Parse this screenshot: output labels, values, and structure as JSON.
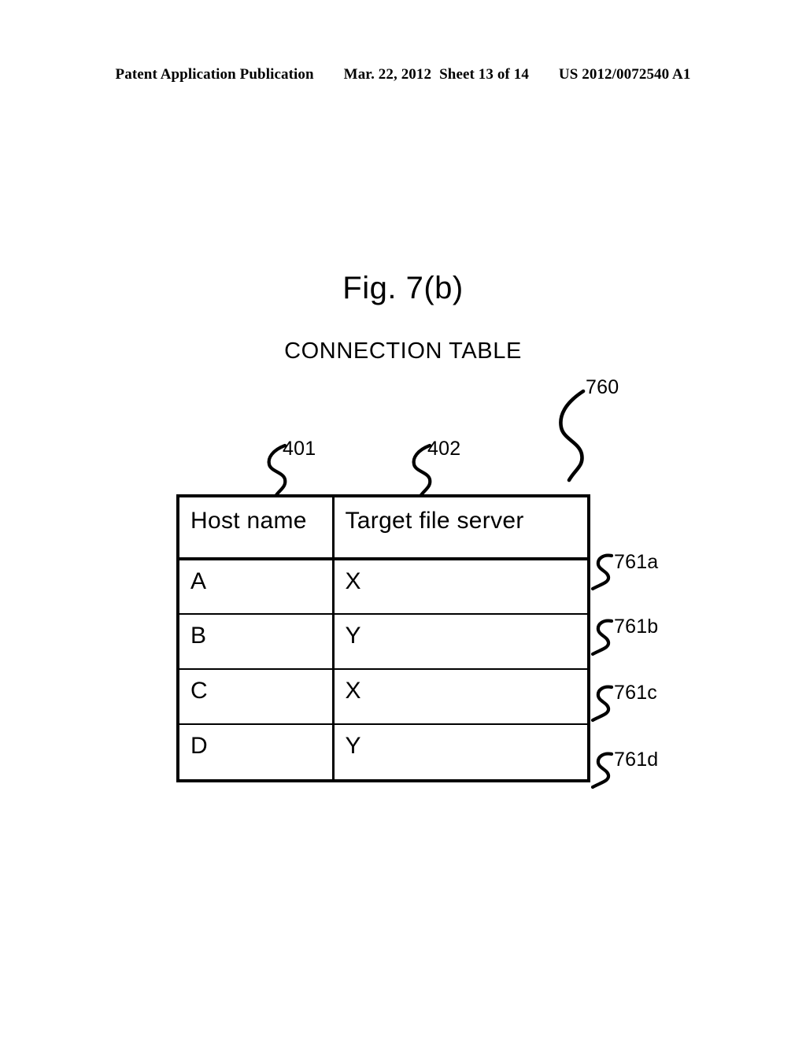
{
  "header": {
    "publication": "Patent Application Publication",
    "date": "Mar. 22, 2012",
    "sheet": "Sheet 13 of 14",
    "number": "US 2012/0072540 A1"
  },
  "figure": {
    "title": "Fig. 7(b)",
    "caption": "CONNECTION TABLE"
  },
  "refs": {
    "table": "760",
    "column_host": "401",
    "column_server": "402",
    "row_a": "761a",
    "row_b": "761b",
    "row_c": "761c",
    "row_d": "761d"
  },
  "table": {
    "columns": [
      "Host name",
      "Target file server"
    ],
    "rows": [
      {
        "host": "A",
        "server": "X"
      },
      {
        "host": "B",
        "server": "Y"
      },
      {
        "host": "C",
        "server": "X"
      },
      {
        "host": "D",
        "server": "Y"
      }
    ]
  },
  "colors": {
    "ink": "#000000",
    "paper": "#ffffff"
  }
}
